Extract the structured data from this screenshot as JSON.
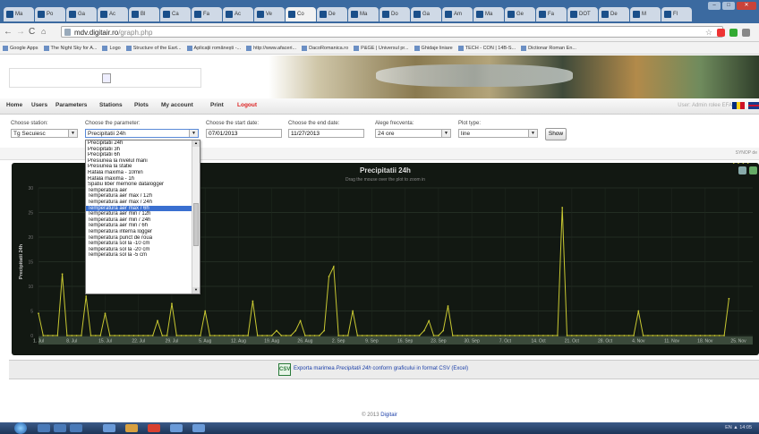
{
  "browser": {
    "tabs": [
      "Ma",
      "Po",
      "Ga",
      "Ac",
      "Bl",
      "Ca",
      "Fa",
      "Ac",
      "Ve",
      "Co",
      "De",
      "Ma",
      "Do",
      "Ga",
      "Am",
      "Ma",
      "Ge",
      "Fa",
      "DOT",
      "De",
      "M",
      "Fl"
    ],
    "window_buttons": {
      "min": "–",
      "max": "□",
      "close": "✕"
    },
    "url_domain": "mdv.digitair.ro",
    "url_path": "/graph.php",
    "bookmarks": [
      "Google Apps",
      "The Night Sky for A...",
      "Logo",
      "Structure of the Eart...",
      "Aplicații românești -...",
      "http://www.afaceri...",
      "DacoRomanica.ro",
      "P&GE | Universul pr...",
      "Ghidaje liniare",
      "TECH - CON | 14B-S...",
      "Dictionar Roman En..."
    ]
  },
  "menu": {
    "items": [
      "Home",
      "Users",
      "Parameters",
      "Stations",
      "Plots",
      "My account",
      "Print"
    ],
    "logout": "Logout",
    "user": "User: Admin rolee EFA"
  },
  "filters": {
    "station_label": "Choose station:",
    "station_value": "Tg Secuiesc",
    "param_label": "Choose the parameter:",
    "param_value": "Precipitatii 24h",
    "start_label": "Choose the start date:",
    "start_value": "07/01/2013",
    "end_label": "Choose the end date:",
    "end_value": "11/27/2013",
    "freq_label": "Alege frecventa:",
    "freq_value": "24 ore",
    "plot_label": "Plot type:",
    "plot_value": "line",
    "show_button": "Show"
  },
  "strip_right": "SYNOP de",
  "dropdown": {
    "options": [
      "Precipitatii 24h",
      "Precipitatii 3h",
      "Precipitatii 6h",
      "Presiunea la nivelul marii",
      "Presiunea la statie",
      "Rafala maxima - 10min",
      "Rafala maxima - 1h",
      "Spatiu liber memorie datalogger",
      "Temperatura aer",
      "Temperatura aer max / 12h",
      "Temperatura aer max / 24h",
      "Temperatura aer max / 6h",
      "Temperatura aer min / 12h",
      "Temperatura aer min / 24h",
      "Temperatura aer min / 6h",
      "Temperatura interna logger",
      "Temperatura punct de roua",
      "Temperatura sol la -10 cm",
      "Temperatura sol la -20 cm",
      "Temperatura sol la -5 cm"
    ],
    "selected_index": 11
  },
  "chart_data": {
    "type": "line",
    "title": "Precipitatii 24h",
    "subtitle": "Drag the mouse over the plot to zoom in",
    "ylabel": "Precipitatii 24h",
    "ylim": [
      0,
      30
    ],
    "yticks": [
      0,
      5,
      10,
      15,
      20,
      25,
      30
    ],
    "xlim": [
      0,
      150
    ],
    "xticks": [
      {
        "v": 0,
        "label": "1. Jul"
      },
      {
        "v": 7,
        "label": "8. Jul"
      },
      {
        "v": 14,
        "label": "15. Jul"
      },
      {
        "v": 21,
        "label": "22. Jul"
      },
      {
        "v": 28,
        "label": "29. Jul"
      },
      {
        "v": 35,
        "label": "5. Aug"
      },
      {
        "v": 42,
        "label": "12. Aug"
      },
      {
        "v": 49,
        "label": "19. Aug"
      },
      {
        "v": 56,
        "label": "26. Aug"
      },
      {
        "v": 63,
        "label": "2. Sep"
      },
      {
        "v": 70,
        "label": "9. Sep"
      },
      {
        "v": 77,
        "label": "16. Sep"
      },
      {
        "v": 84,
        "label": "23. Sep"
      },
      {
        "v": 91,
        "label": "30. Sep"
      },
      {
        "v": 98,
        "label": "7. Oct"
      },
      {
        "v": 105,
        "label": "14. Oct"
      },
      {
        "v": 112,
        "label": "21. Oct"
      },
      {
        "v": 119,
        "label": "28. Oct"
      },
      {
        "v": 126,
        "label": "4. Nov"
      },
      {
        "v": 133,
        "label": "11. Nov"
      },
      {
        "v": 140,
        "label": "18. Nov"
      },
      {
        "v": 147,
        "label": "25. Nov"
      }
    ],
    "x": [
      0,
      1,
      2,
      3,
      4,
      5,
      6,
      7,
      8,
      9,
      10,
      11,
      12,
      13,
      14,
      15,
      16,
      17,
      18,
      19,
      20,
      21,
      22,
      23,
      24,
      25,
      26,
      27,
      28,
      29,
      30,
      31,
      32,
      33,
      34,
      35,
      36,
      37,
      38,
      39,
      40,
      41,
      42,
      43,
      44,
      45,
      46,
      47,
      48,
      49,
      50,
      51,
      52,
      53,
      54,
      55,
      56,
      57,
      58,
      59,
      60,
      61,
      62,
      63,
      64,
      65,
      66,
      67,
      68,
      69,
      70,
      71,
      72,
      73,
      74,
      75,
      76,
      77,
      78,
      79,
      80,
      81,
      82,
      83,
      84,
      85,
      86,
      87,
      88,
      89,
      90,
      91,
      92,
      93,
      94,
      95,
      96,
      97,
      98,
      99,
      100,
      101,
      102,
      103,
      104,
      105,
      106,
      107,
      108,
      109,
      110,
      111,
      112,
      113,
      114,
      115,
      116,
      117,
      118,
      119,
      120,
      121,
      122,
      123,
      124,
      125,
      126,
      127,
      128,
      129,
      130,
      131,
      132,
      133,
      134,
      135,
      136,
      137,
      138,
      139,
      140,
      141,
      142,
      143,
      144,
      145,
      146,
      147,
      148,
      149
    ],
    "values": [
      4.5,
      0,
      0,
      0,
      0,
      12.5,
      0,
      0,
      0,
      0,
      8,
      0,
      0,
      0,
      4.5,
      0,
      0,
      0,
      0,
      0,
      0,
      0,
      0,
      0,
      0,
      3,
      0,
      0,
      6.5,
      0,
      0,
      0,
      0,
      0,
      0,
      5,
      0,
      0,
      0,
      0,
      0,
      0,
      0,
      0,
      0,
      7,
      0,
      0,
      0,
      0,
      1,
      0,
      0,
      0,
      1,
      3,
      0,
      0,
      0,
      0,
      1,
      12,
      14,
      0,
      0,
      0,
      5,
      0,
      0,
      0,
      0,
      0,
      0,
      0,
      0,
      0,
      0,
      0,
      0,
      0,
      0,
      1,
      3,
      0,
      0,
      1,
      6,
      0,
      0,
      0,
      0,
      0,
      0,
      0,
      0,
      0,
      0,
      0,
      0,
      0,
      0,
      0,
      0,
      0,
      0,
      0,
      0,
      0,
      0,
      0,
      26,
      0,
      0,
      0,
      0,
      0,
      0,
      0,
      0,
      0,
      0,
      0,
      0,
      0,
      0,
      0,
      5,
      0,
      0,
      0,
      0,
      0,
      0,
      0,
      0,
      0,
      0,
      0,
      0,
      0,
      0,
      0,
      0,
      0,
      0,
      7.5
    ],
    "series_color": "#c8c832"
  },
  "export": {
    "icon": "CSV",
    "text_before": "Exporta marimea ",
    "text_param": "Precipitatii 24h",
    "text_after": " conform graficului in format CSV (Excel)"
  },
  "footer": {
    "text": "© 2013 ",
    "link": "Digitair"
  },
  "taskbar": {
    "tray_text": "EN ▲ 14:05"
  }
}
